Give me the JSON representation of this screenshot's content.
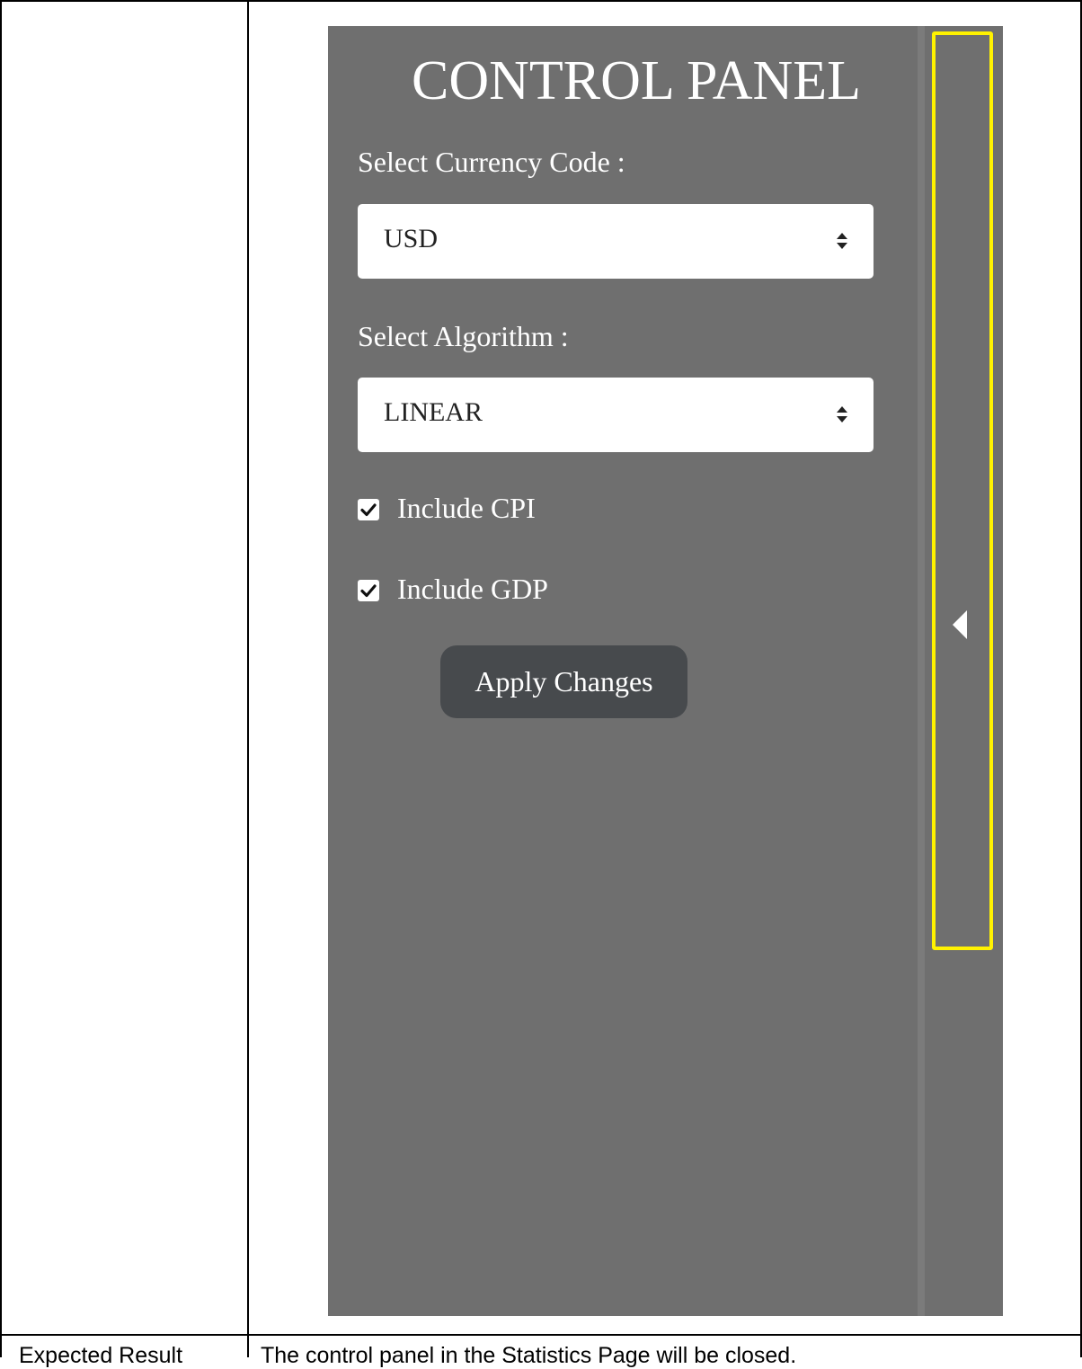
{
  "control_panel": {
    "title": "CONTROL PANEL",
    "currency_label": "Select Currency Code :",
    "currency_value": "USD",
    "algorithm_label": "Select Algorithm :",
    "algorithm_value": "LINEAR",
    "checkboxes": [
      {
        "label": "Include CPI",
        "checked": true
      },
      {
        "label": "Include GDP",
        "checked": true
      }
    ],
    "apply_label": "Apply Changes",
    "colors": {
      "panel_background": "#6f6f6f",
      "button_background": "#474a4d",
      "highlight": "#fff200"
    },
    "icons": {
      "select_arrows": "sort-arrows-icon",
      "checkbox": "checkmark-icon",
      "collapse": "caret-left-icon"
    }
  },
  "table": {
    "rows": [
      {
        "label": "Expected Result",
        "value": "The control panel in the Statistics Page will be closed."
      }
    ]
  }
}
